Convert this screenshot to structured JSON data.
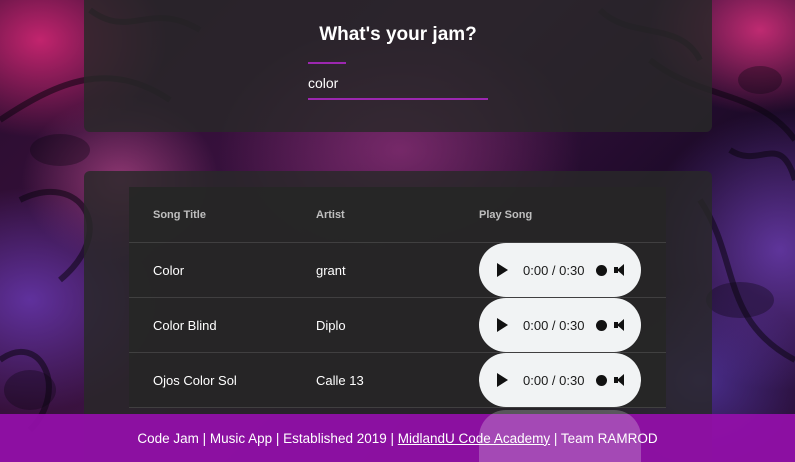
{
  "header": {
    "title": "What's your jam?",
    "search_value": "color"
  },
  "table": {
    "columns": [
      "Song Title",
      "Artist",
      "Play Song"
    ],
    "rows": [
      {
        "title": "Color",
        "artist": "grant",
        "time": "0:00 / 0:30"
      },
      {
        "title": "Color Blind",
        "artist": "Diplo",
        "time": "0:00 / 0:30"
      },
      {
        "title": "Ojos Color Sol",
        "artist": "Calle 13",
        "time": "0:00 / 0:30"
      }
    ]
  },
  "footer": {
    "text_before": "Code Jam | Music App | Established 2019 | ",
    "link": "MidlandU Code Academy",
    "text_after": " | Team RAMROD"
  },
  "colors": {
    "accent": "#9c27b0",
    "footer_bg": "#930faa",
    "panel_bg": "#282828"
  }
}
